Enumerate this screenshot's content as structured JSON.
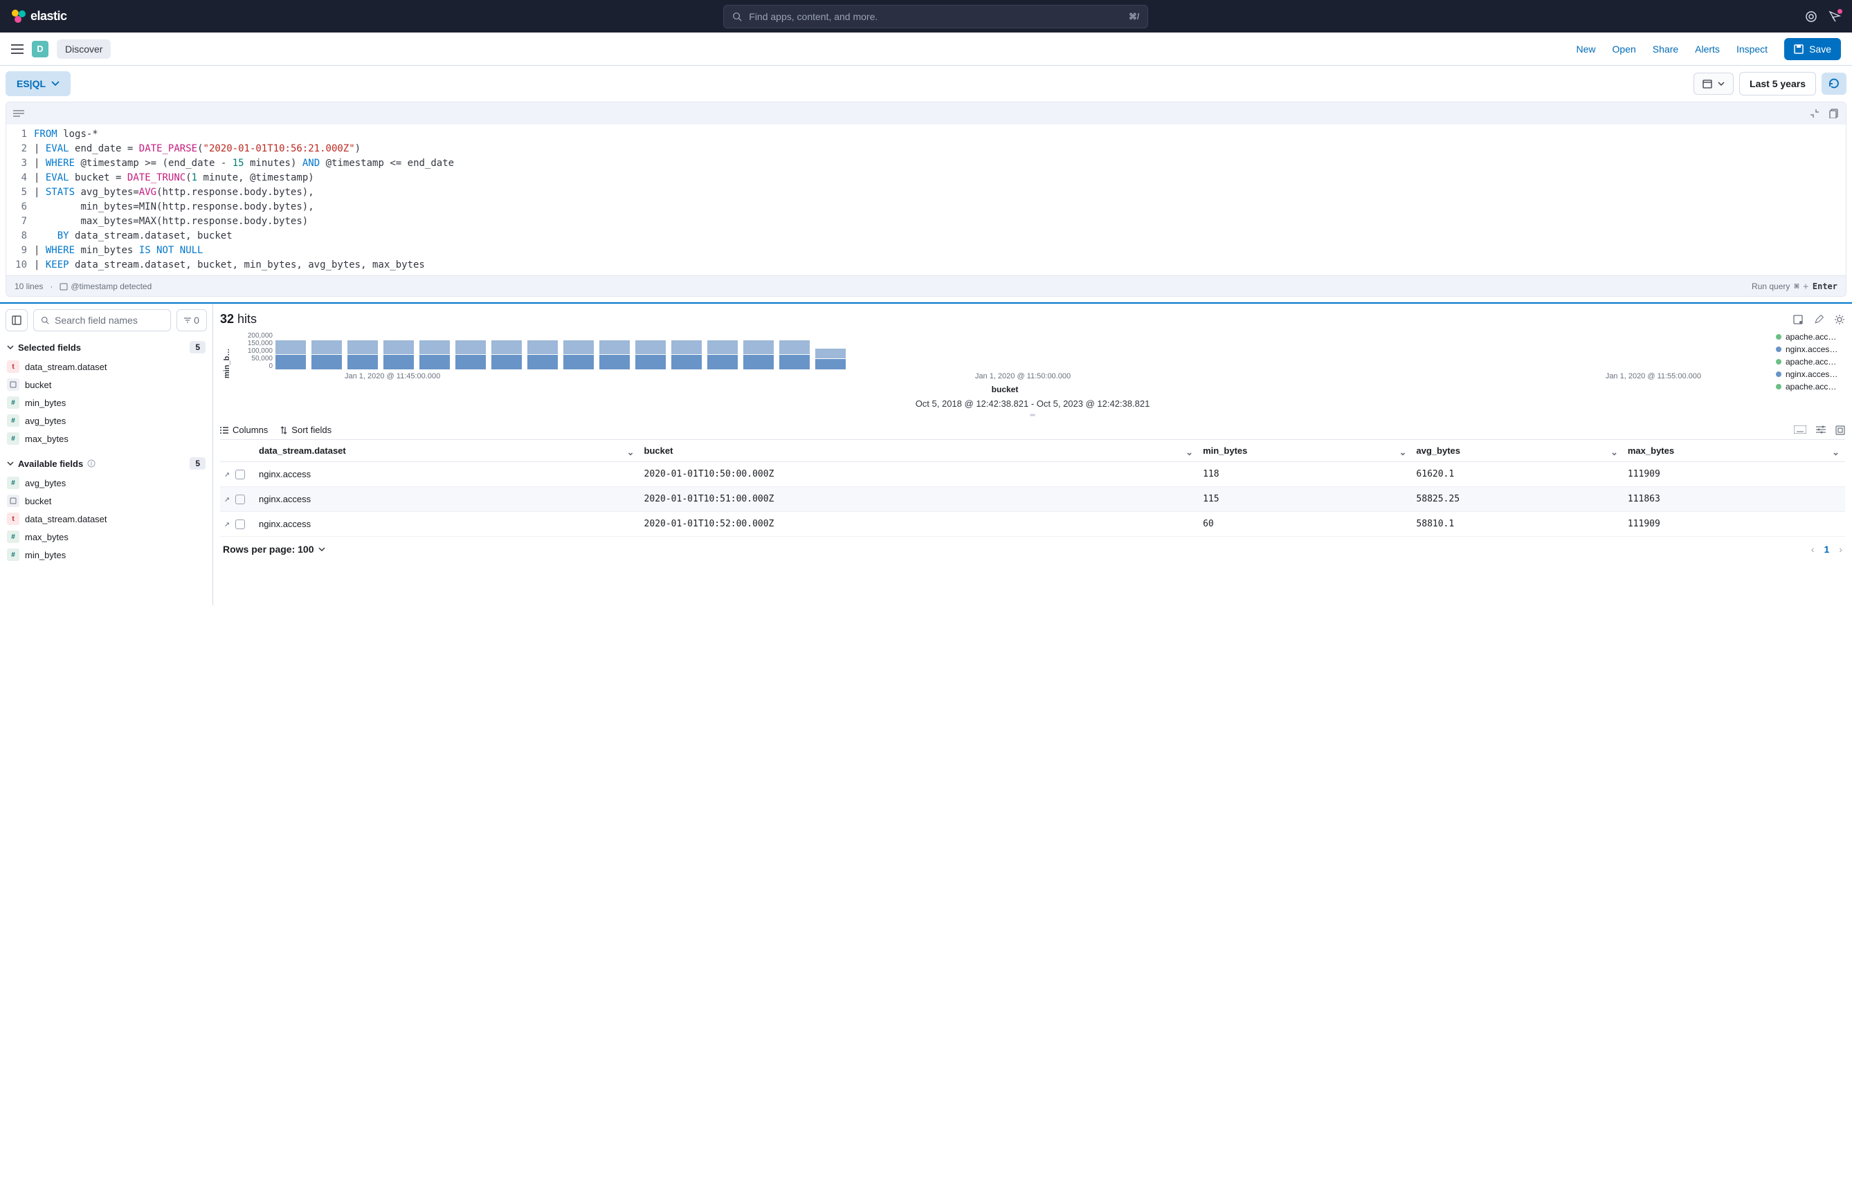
{
  "header": {
    "brand": "elastic",
    "search_placeholder": "Find apps, content, and more.",
    "search_shortcut": "⌘/"
  },
  "subheader": {
    "badge_letter": "D",
    "app_name": "Discover",
    "links": [
      "New",
      "Open",
      "Share",
      "Alerts",
      "Inspect"
    ],
    "save_label": "Save"
  },
  "toolbar": {
    "mode_label": "ES|QL",
    "time_range": "Last 5 years"
  },
  "editor": {
    "lines_label": "10 lines",
    "timestamp_label": "@timestamp detected",
    "run_label": "Run query",
    "run_kbd_a": "⌘",
    "run_kbd_plus": "+",
    "run_kbd_b": "Enter",
    "code_lines": [
      {
        "ln": 1,
        "html": "<span class='kw'>FROM</span> <span class='ident'>logs-*</span>"
      },
      {
        "ln": 2,
        "html": "<span class='punc'>|</span> <span class='kw'>EVAL</span> <span class='ident'>end_date</span> <span class='punc'>=</span> <span class='fn'>DATE_PARSE</span><span class='punc'>(</span><span class='str'>\"2020-01-01T10:56:21.000Z\"</span><span class='punc'>)</span>"
      },
      {
        "ln": 3,
        "html": "<span class='punc'>|</span> <span class='kw'>WHERE</span> <span class='ident'>@timestamp</span> <span class='punc'>&gt;=</span> <span class='punc'>(</span><span class='ident'>end_date</span> <span class='punc'>-</span> <span class='num2'>15</span> <span class='ident'>minutes</span><span class='punc'>)</span> <span class='kw'>AND</span> <span class='ident'>@timestamp</span> <span class='punc'>&lt;=</span> <span class='ident'>end_date</span>"
      },
      {
        "ln": 4,
        "html": "<span class='punc'>|</span> <span class='kw'>EVAL</span> <span class='ident'>bucket</span> <span class='punc'>=</span> <span class='fn'>DATE_TRUNC</span><span class='punc'>(</span><span class='num2'>1</span> <span class='ident'>minute</span><span class='punc'>,</span> <span class='ident'>@timestamp</span><span class='punc'>)</span>"
      },
      {
        "ln": 5,
        "html": "<span class='punc'>|</span> <span class='kw'>STATS</span> <span class='ident'>avg_bytes</span><span class='punc'>=</span><span class='fn'>AVG</span><span class='punc'>(</span><span class='ident'>http.response.body.bytes</span><span class='punc'>),</span>"
      },
      {
        "ln": 6,
        "html": "        <span class='ident'>min_bytes</span><span class='punc'>=</span><span class='ident'>MIN</span><span class='punc'>(</span><span class='ident'>http.response.body.bytes</span><span class='punc'>),</span>"
      },
      {
        "ln": 7,
        "html": "        <span class='ident'>max_bytes</span><span class='punc'>=</span><span class='ident'>MAX</span><span class='punc'>(</span><span class='ident'>http.response.body.bytes</span><span class='punc'>)</span>"
      },
      {
        "ln": 8,
        "html": "    <span class='kw'>BY</span> <span class='ident'>data_stream.dataset</span><span class='punc'>,</span> <span class='ident'>bucket</span>"
      },
      {
        "ln": 9,
        "html": "<span class='punc'>|</span> <span class='kw'>WHERE</span> <span class='ident'>min_bytes</span> <span class='kw'>IS NOT NULL</span>"
      },
      {
        "ln": 10,
        "html": "<span class='punc'>|</span> <span class='kw'>KEEP</span> <span class='ident'>data_stream.dataset</span><span class='punc'>,</span> <span class='ident'>bucket</span><span class='punc'>,</span> <span class='ident'>min_bytes</span><span class='punc'>,</span> <span class='ident'>avg_bytes</span><span class='punc'>,</span> <span class='ident'>max_bytes</span>"
      }
    ]
  },
  "sidebar": {
    "search_placeholder": "Search field names",
    "filter_count": "0",
    "selected": {
      "title": "Selected fields",
      "count": "5",
      "fields": [
        {
          "type": "t",
          "name": "data_stream.dataset"
        },
        {
          "type": "date",
          "name": "bucket"
        },
        {
          "type": "num",
          "name": "min_bytes"
        },
        {
          "type": "num",
          "name": "avg_bytes"
        },
        {
          "type": "num",
          "name": "max_bytes"
        }
      ]
    },
    "available": {
      "title": "Available fields",
      "count": "5",
      "fields": [
        {
          "type": "num",
          "name": "avg_bytes"
        },
        {
          "type": "date",
          "name": "bucket"
        },
        {
          "type": "t",
          "name": "data_stream.dataset"
        },
        {
          "type": "num",
          "name": "max_bytes"
        },
        {
          "type": "num",
          "name": "min_bytes"
        }
      ]
    }
  },
  "results": {
    "hits_number": "32",
    "hits_label": "hits",
    "y_label": "min_b…",
    "x_label": "bucket",
    "y_ticks": [
      "200,000",
      "150,000",
      "100,000",
      "50,000",
      "0"
    ],
    "x_ticks": [
      "Jan 1, 2020 @ 11:45:00.000",
      "Jan 1, 2020 @ 11:50:00.000",
      "Jan 1, 2020 @ 11:55:00.000"
    ],
    "legend": [
      {
        "color": "#6cbf84",
        "label": "apache.acc…"
      },
      {
        "color": "#6894c8",
        "label": "nginx.acces…"
      },
      {
        "color": "#6cbf84",
        "label": "apache.acc…"
      },
      {
        "color": "#6894c8",
        "label": "nginx.acces…"
      },
      {
        "color": "#6cbf84",
        "label": "apache.acc…"
      }
    ],
    "time_span": "Oct 5, 2018 @ 12:42:38.821 - Oct 5, 2023 @ 12:42:38.821",
    "columns_btn": "Columns",
    "sort_btn": "Sort fields",
    "headers": [
      "data_stream.dataset",
      "bucket",
      "min_bytes",
      "avg_bytes",
      "max_bytes"
    ],
    "rows": [
      {
        "dataset": "nginx.access",
        "bucket": "2020-01-01T10:50:00.000Z",
        "min": "118",
        "avg": "61620.1",
        "max": "111909"
      },
      {
        "dataset": "nginx.access",
        "bucket": "2020-01-01T10:51:00.000Z",
        "min": "115",
        "avg": "58825.25",
        "max": "111863"
      },
      {
        "dataset": "nginx.access",
        "bucket": "2020-01-01T10:52:00.000Z",
        "min": "60",
        "avg": "58810.1",
        "max": "111909"
      }
    ],
    "rpp": "Rows per page: 100",
    "page": "1"
  },
  "chart_data": {
    "type": "bar",
    "title": "",
    "xlabel": "bucket",
    "ylabel": "min_b…",
    "ylim": [
      0,
      200000
    ],
    "series": [
      {
        "name": "apache.access",
        "color": "#9db8d8"
      },
      {
        "name": "nginx.access",
        "color": "#6894c8"
      }
    ],
    "bars_count": 16,
    "stacked_approx": {
      "bottom": 100000,
      "top": 100000
    },
    "x_tick_labels": [
      "Jan 1, 2020 @ 11:45:00.000",
      "Jan 1, 2020 @ 11:50:00.000",
      "Jan 1, 2020 @ 11:55:00.000"
    ]
  }
}
